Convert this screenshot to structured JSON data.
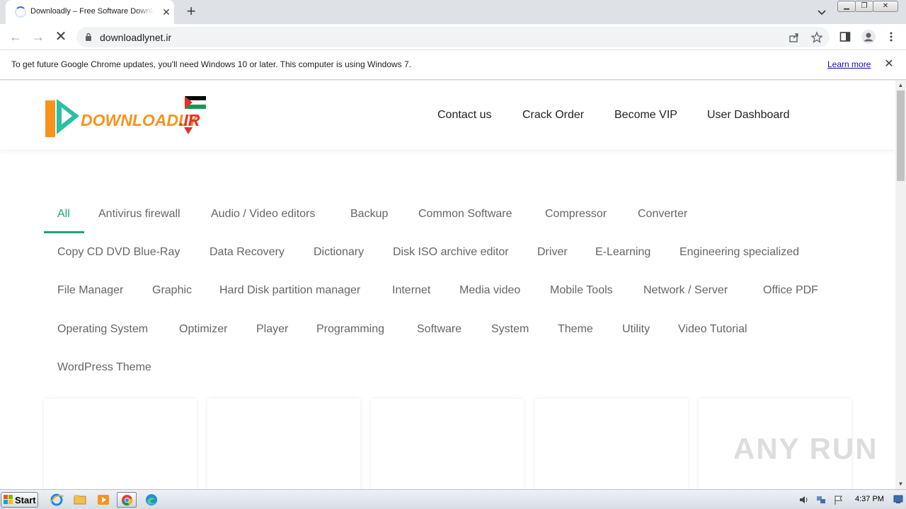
{
  "browser": {
    "tab_title": "Downloadly – Free Software Download",
    "url": "downloadlynet.ir",
    "infobar_text": "To get future Google Chrome updates, you'll need Windows 10 or later. This computer is using Windows 7.",
    "infobar_link": "Learn more"
  },
  "site": {
    "logo_text": "DOWNLOADLY.IR",
    "nav": [
      "Contact us",
      "Crack Order",
      "Become VIP",
      "User Dashboard"
    ],
    "categories": [
      "All",
      "Antivirus firewall",
      "Audio / Video editors",
      "Backup",
      "Common Software",
      "Compressor",
      "Converter",
      "Copy CD DVD Blue-Ray",
      "Data Recovery",
      "Dictionary",
      "Disk ISO archive editor",
      "Driver",
      "E-Learning",
      "Engineering specialized",
      "File Manager",
      "Graphic",
      "Hard Disk partition manager",
      "Internet",
      "Media video",
      "Mobile Tools",
      "Network / Server",
      "Office PDF",
      "Operating System",
      "Optimizer",
      "Player",
      "Programming",
      "Software",
      "System",
      "Theme",
      "Utility",
      "Video Tutorial",
      "WordPress Theme"
    ],
    "active_category": "All",
    "accent_color": "#1aa37a"
  },
  "watermark": "ANY RUN",
  "taskbar": {
    "start_label": "Start",
    "apps": [
      "internet-explorer-icon",
      "folder-icon",
      "media-player-icon",
      "chrome-icon",
      "edge-icon"
    ],
    "clock": "4:37 PM"
  }
}
